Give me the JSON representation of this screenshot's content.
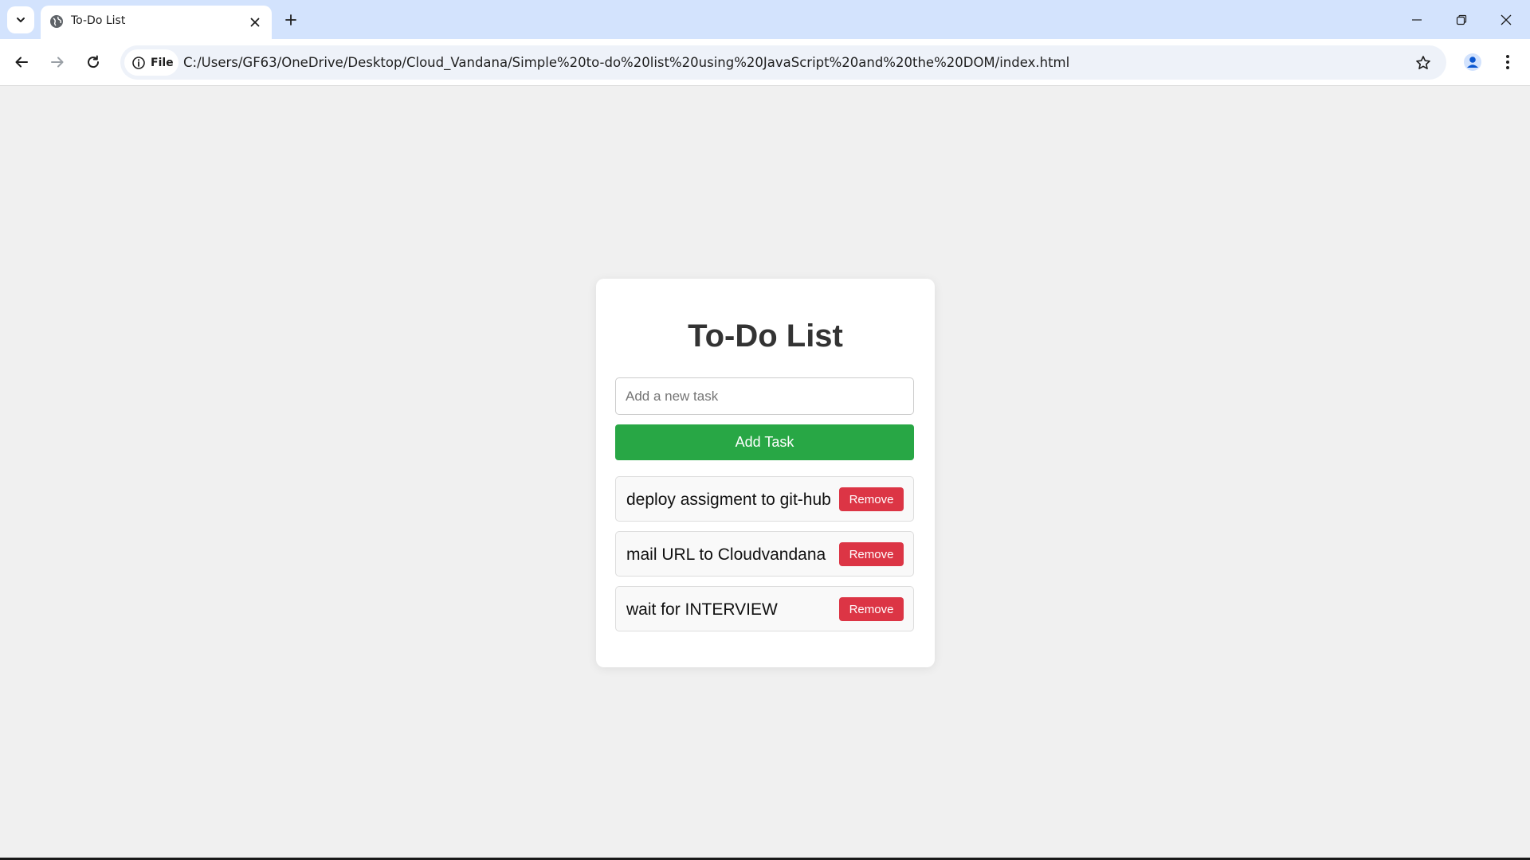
{
  "browser": {
    "tab": {
      "title": "To-Do List"
    },
    "site_chip_label": "File",
    "url": "C:/Users/GF63/OneDrive/Desktop/Cloud_Vandana/Simple%20to-do%20list%20using%20JavaScript%20and%20the%20DOM/index.html",
    "colors": {
      "tabstrip": "#d3e3fd",
      "omnibox": "#eef2f9"
    }
  },
  "page": {
    "title": "To-Do List",
    "task_input": {
      "placeholder": "Add a new task",
      "value": ""
    },
    "add_button_label": "Add Task",
    "tasks": [
      {
        "text": "deploy assigment to git-hub",
        "remove_label": "Remove"
      },
      {
        "text": "mail URL to Cloudvandana",
        "remove_label": "Remove"
      },
      {
        "text": "wait for INTERVIEW",
        "remove_label": "Remove"
      }
    ],
    "colors": {
      "add_button": "#28a745",
      "remove_button": "#dc3545",
      "background": "#f0f0f0"
    }
  }
}
